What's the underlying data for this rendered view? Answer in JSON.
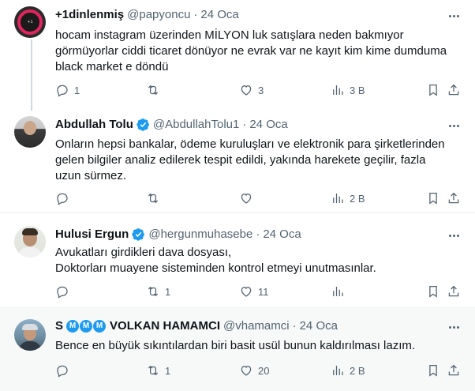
{
  "tweets": [
    {
      "name": "+1dinlenmiş",
      "handle": "@papyoncu",
      "sep": "·",
      "date": "24 Oca",
      "verified": false,
      "avatar_icon": "avatar-dark-logo",
      "text": "hocam instagram üzerinden MİLYON luk satışlara neden bakmıyor\ngörmüyorlar ciddi ticaret dönüyor ne evrak var ne kayıt kim kime dumduma\n black market e döndü",
      "replies": "1",
      "retweets": "",
      "likes": "3",
      "views": "3 B"
    },
    {
      "name": "Abdullah Tolu",
      "handle": "@AbdullahTolu1",
      "sep": "·",
      "date": "24 Oca",
      "verified": true,
      "text": "Onların hepsi bankalar, ödeme kuruluşları ve elektronik para şirketlerinden\ngelen bilgiler analiz edilerek tespit edildi, yakında harekete geçilir, fazla\nuzun sürmez.",
      "replies": "",
      "retweets": "",
      "likes": "",
      "views": "2 B"
    },
    {
      "name": "Hulusi Ergun",
      "handle": "@hergunmuhasebe",
      "sep": "·",
      "date": "24 Oca",
      "verified": true,
      "text": "Avukatları girdikleri dava dosyası,\nDoktorları muayene sisteminden kontrol etmeyi unutmasınlar.",
      "replies": "",
      "retweets": "1",
      "likes": "11",
      "views": ""
    },
    {
      "name_prefix": "S",
      "name_badges": [
        "M",
        "M",
        "M"
      ],
      "name": "VOLKAN HAMAMCI",
      "handle": "@vhamamci",
      "sep": "·",
      "date": "24 Oca",
      "verified": false,
      "text": "Bence en büyük sıkıntılardan biri basit usül bunun kaldırılması lazım.",
      "replies": "",
      "retweets": "1",
      "likes": "20",
      "views": "2 B"
    }
  ],
  "colors": {
    "text": "#0f1419",
    "secondary": "#536471",
    "verified": "#1d9bf0",
    "highlight_bg": "#f7f9f9"
  }
}
